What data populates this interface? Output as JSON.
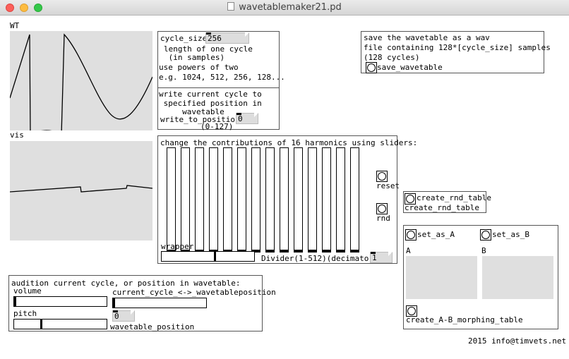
{
  "window": {
    "title": "wavetablemaker21.pd"
  },
  "wt_graph": {
    "label": "WT"
  },
  "vis_graph": {
    "label": "vis"
  },
  "cycle_box": {
    "atom_label": "cycle_size",
    "cycle_size_value": "256",
    "lines": [
      "length of one cycle",
      " (in samples)",
      "use powers of two",
      "e.g. 1024, 512, 256, 128..."
    ]
  },
  "write_box": {
    "lines": [
      "write current cycle to",
      " specified position in",
      "     wavetable"
    ],
    "atom_label": "write_to_position",
    "value": "0",
    "range": "(0-127)"
  },
  "save_box": {
    "lines": [
      "save the wavetable as a wav",
      "file containing 128*[cycle_size] samples",
      "(128 cycles)"
    ],
    "bang_label": "save_wavetable"
  },
  "harmonics_box": {
    "title": "change the contributions of 16 harmonics using sliders:",
    "sliders": [
      0.0,
      0.0,
      0.0,
      0.0,
      0.0,
      0.0,
      0.0,
      0.0,
      0.0,
      0.0,
      0.0,
      0.0,
      0.0,
      0.0
    ],
    "reset_label": "reset",
    "rnd_label": "rnd",
    "wrapper_label": "wrapper",
    "wrapper_value": 0.58,
    "divider_label": "Divider(1-512)(decimator)",
    "divider_value": "1"
  },
  "rnd_table": {
    "bang_label": "create_rnd_table",
    "object_label": "create_rnd_table"
  },
  "morph_box": {
    "set_a_label": "set_as_A",
    "set_b_label": "set_as_B",
    "a_label": "A",
    "b_label": "B",
    "create_label": "create_A-B_morphing_table"
  },
  "audition_box": {
    "title": "audition current cycle, or position in wavetable:",
    "volume_label": "volume",
    "volume_value": 0.0,
    "pitch_label": "pitch",
    "pitch_value": 0.29,
    "crossfade_label": "current_cycle_<->_wavetableposition",
    "crossfade_value": 0.0,
    "position_label": "wavetable_position",
    "position_value": "0"
  },
  "footer": {
    "credit": "2015 info@timvets.net"
  }
}
